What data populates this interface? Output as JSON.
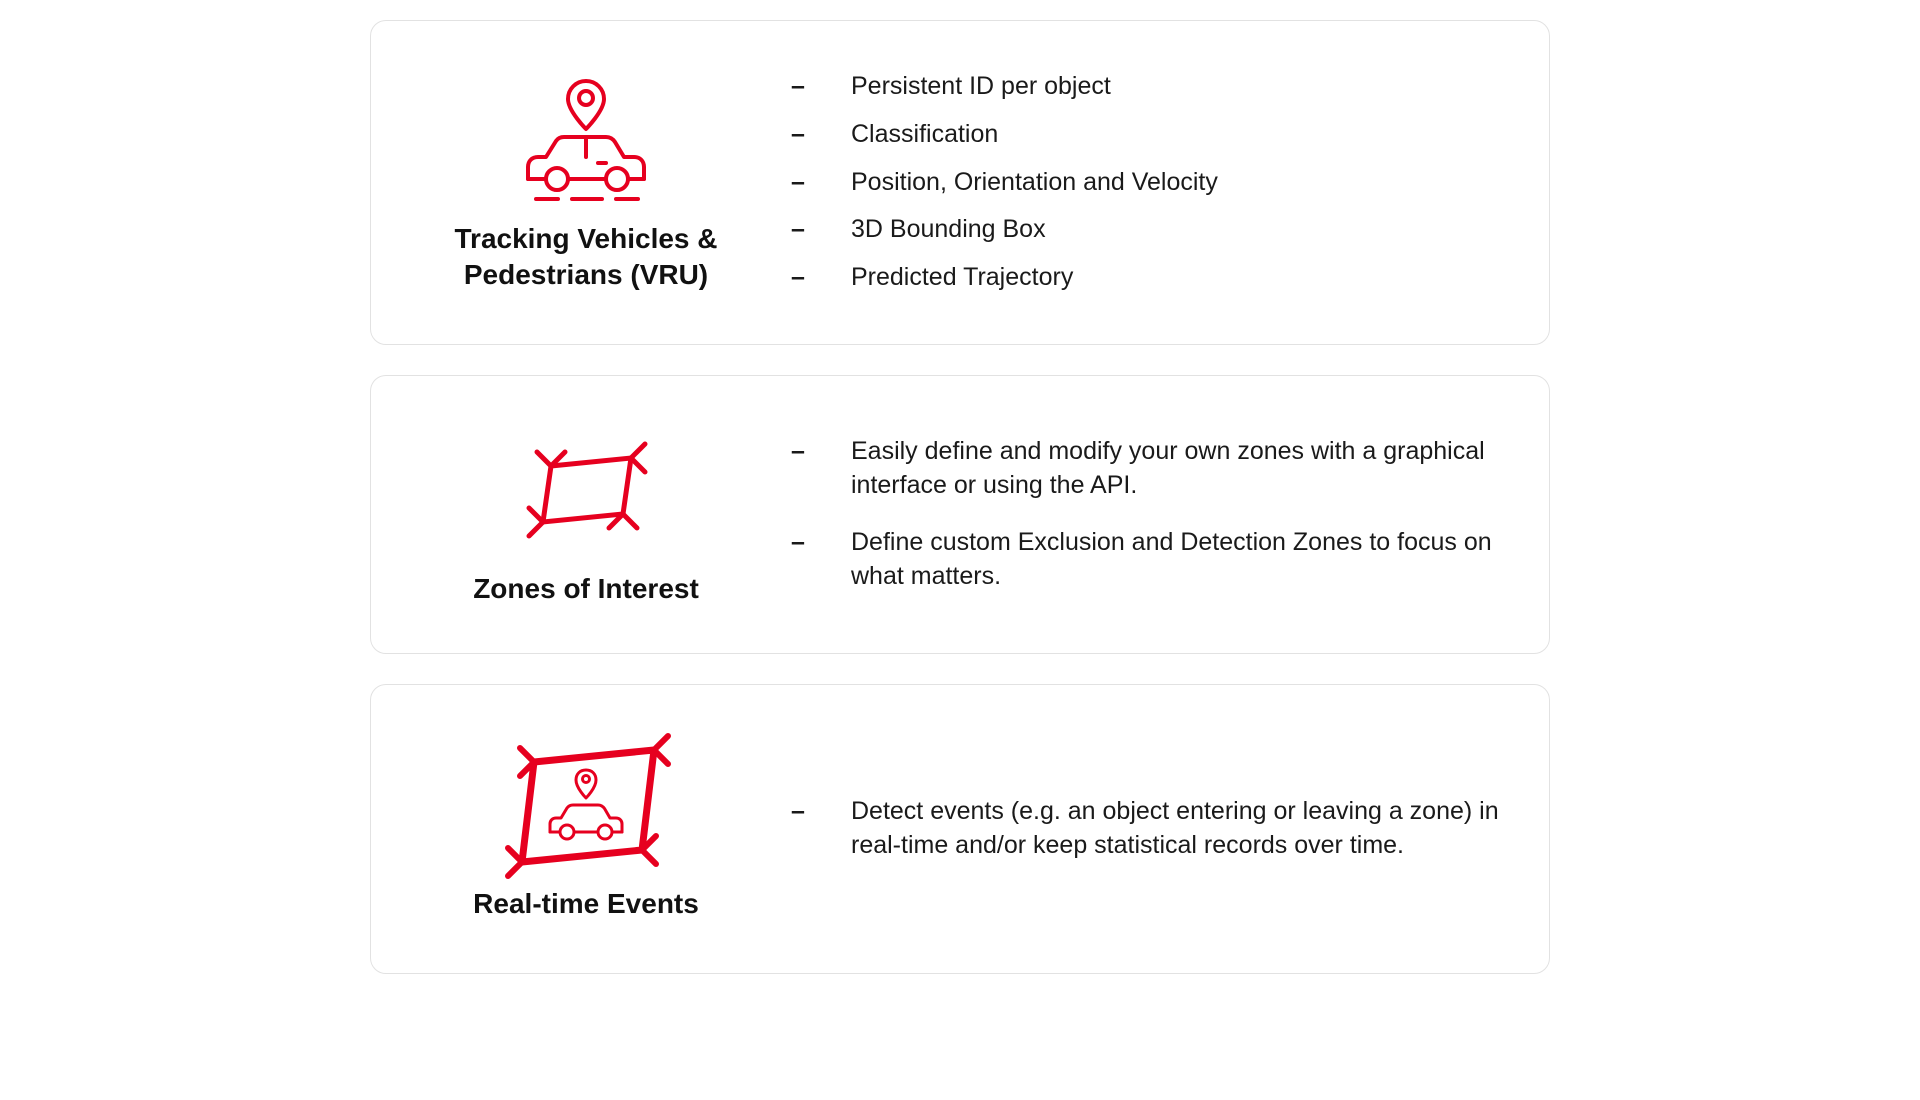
{
  "accent": "#e6001f",
  "cards": [
    {
      "icon": "car-with-pin-icon",
      "title": "Tracking Vehicles & Pedestrians (VRU)",
      "bullets": [
        "Persistent ID per object",
        "Classification",
        "Position, Orientation and Velocity",
        "3D Bounding Box",
        "Predicted Trajectory"
      ]
    },
    {
      "icon": "zone-crop-icon",
      "title": "Zones of Interest",
      "bullets": [
        "Easily define and modify your own zones with a graphical interface or using the API.",
        "Define custom Exclusion and Detection Zones  to focus on what matters."
      ]
    },
    {
      "icon": "zone-with-car-icon",
      "title": "Real-time Events",
      "bullets": [
        "Detect events (e.g. an object entering or leaving a zone) in real-time and/or keep statistical records over time."
      ]
    }
  ]
}
